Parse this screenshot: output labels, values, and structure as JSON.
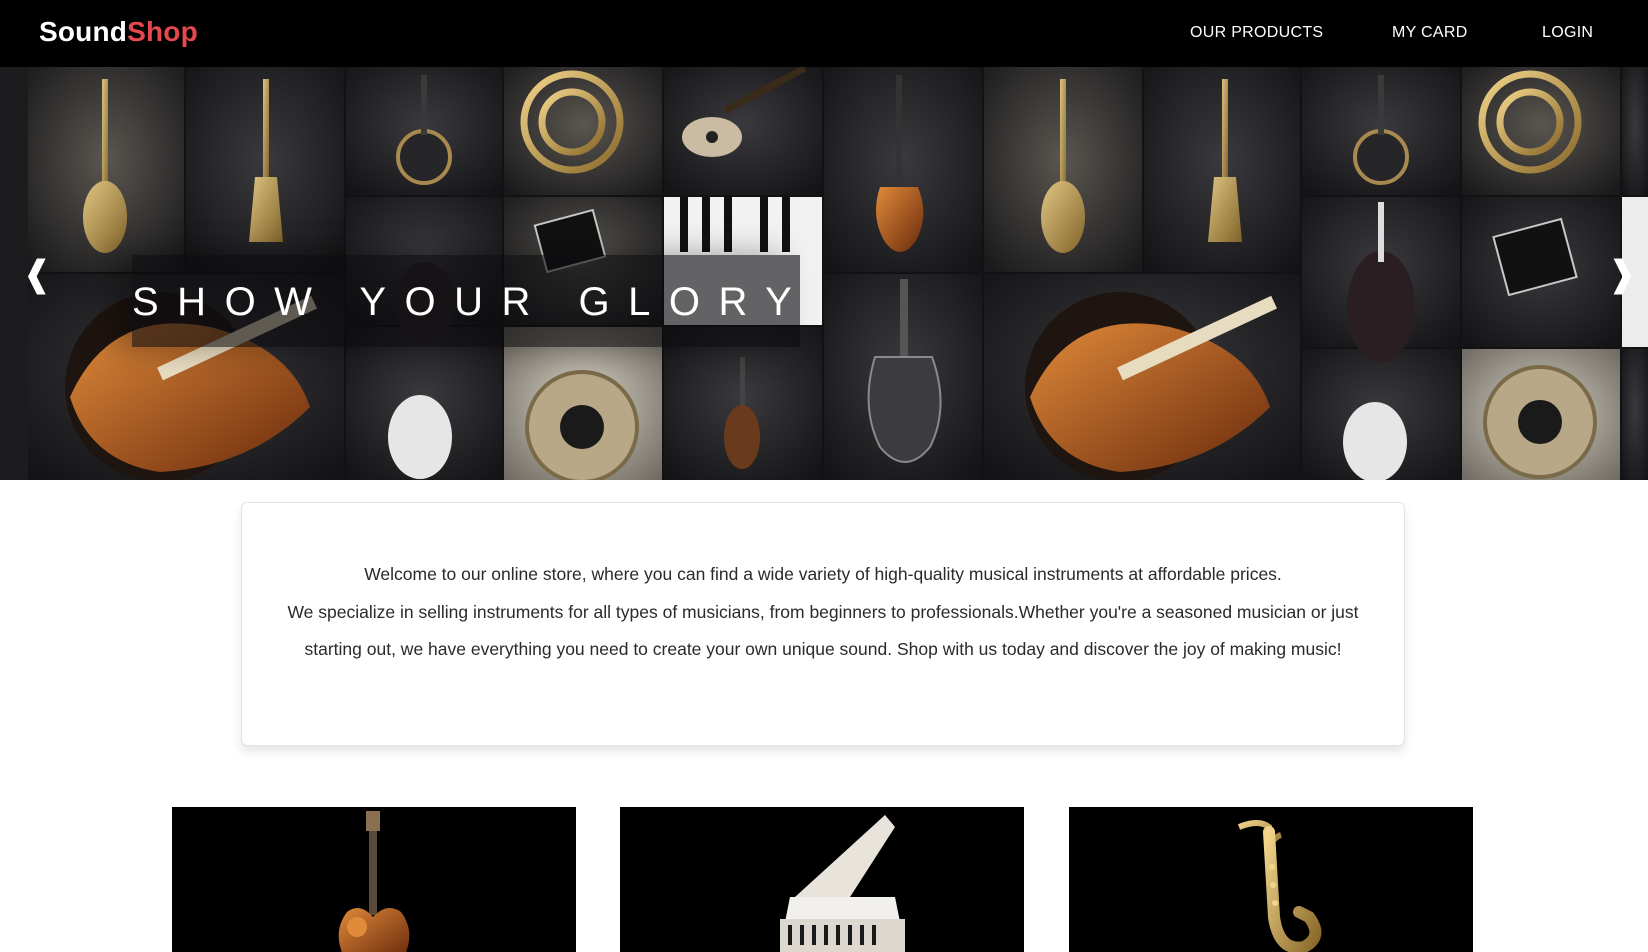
{
  "nav": {
    "logo_part1": "Sound",
    "logo_part2": "Shop",
    "links": [
      "OUR PRODUCTS",
      "MY CARD",
      "LOGIN"
    ]
  },
  "hero": {
    "title": "SHOW YOUR GLORY",
    "prev_icon": "chevron-left-icon",
    "next_icon": "chevron-right-icon",
    "prev_glyph": "❰",
    "next_glyph": "❱"
  },
  "welcome": {
    "line1": "Welcome to our online store, where you can find a wide variety of high-quality musical instruments at affordable prices.",
    "line2": "We specialize in selling instruments for all types of musicians, from beginners to professionals.Whether you're a seasoned musician or just starting out, we have everything you need to create your own unique sound. Shop with us today and discover the joy of making music!"
  },
  "products": [
    {
      "icon": "electric-guitar-image"
    },
    {
      "icon": "grand-piano-image"
    },
    {
      "icon": "saxophone-image"
    }
  ],
  "colors": {
    "navbar": "#000000",
    "logo_accent": "#e5484d",
    "hero_bg": "#121214"
  }
}
